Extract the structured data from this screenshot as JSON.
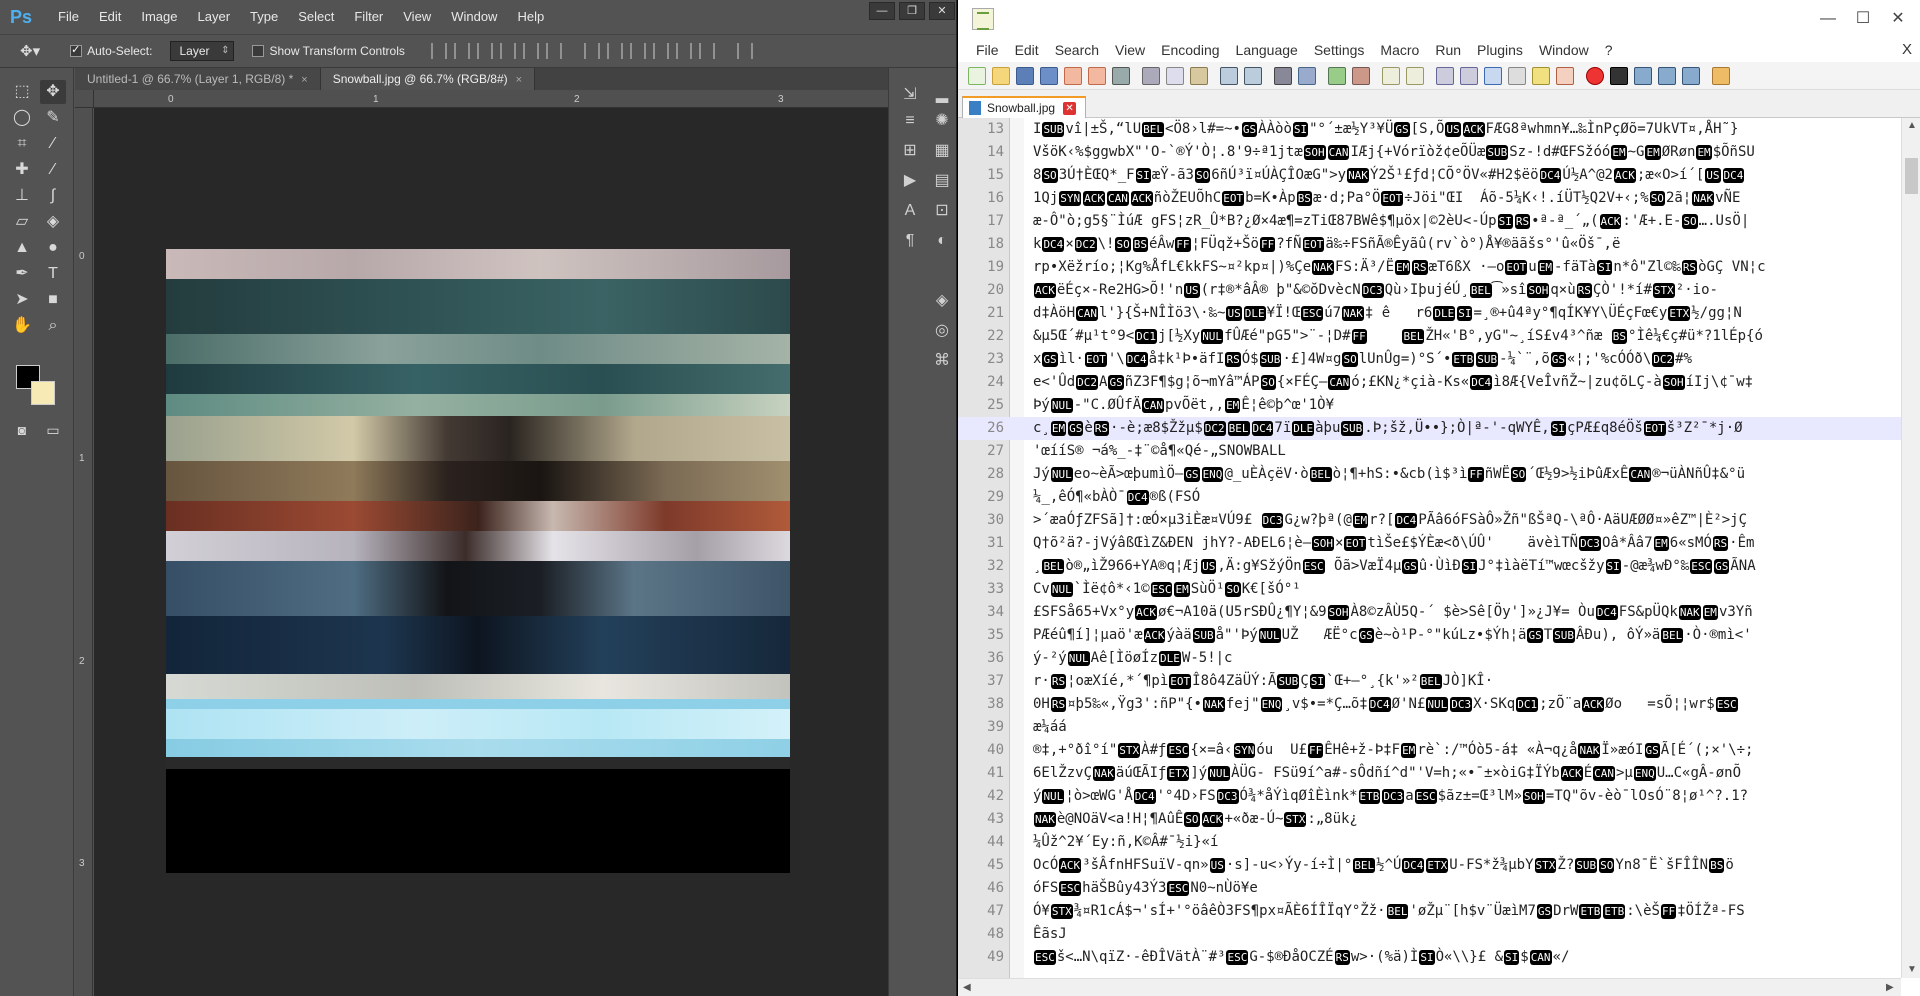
{
  "photoshop": {
    "logo": "Ps",
    "menu": [
      "File",
      "Edit",
      "Image",
      "Layer",
      "Type",
      "Select",
      "Filter",
      "View",
      "Window",
      "Help"
    ],
    "window_controls": [
      "—",
      "❐",
      "✕"
    ],
    "options": {
      "auto_select_label": "Auto-Select:",
      "auto_select_value": "Layer",
      "show_transform_label": "Show Transform Controls"
    },
    "tabs": [
      {
        "label": "Untitled-1 @ 66.7% (Layer 1, RGB/8) *",
        "close": "×"
      },
      {
        "label": "Snowball.jpg @ 66.7% (RGB/8#)",
        "close": "×"
      }
    ],
    "ruler_h_ticks": [
      "0",
      "1",
      "2",
      "3"
    ],
    "ruler_v_ticks": [
      "0",
      "1",
      "2",
      "3"
    ],
    "colors": {
      "foreground": "#000000",
      "background": "#f8eab5"
    }
  },
  "notepadpp": {
    "window_controls": [
      "—",
      "☐",
      "✕"
    ],
    "menu": [
      "File",
      "Edit",
      "Search",
      "View",
      "Encoding",
      "Language",
      "Settings",
      "Macro",
      "Run",
      "Plugins",
      "Window",
      "?"
    ],
    "menu_close": "X",
    "tab": {
      "label": "Snowball.jpg"
    },
    "lines": [
      {
        "n": "13",
        "t": "ISUBvî|±Š,“lUBEL<Ö8›l#=~•GSÀÀòòSI\"°´±æ½Y³¥ÜGS[S,ÕUSACKFÆG8ªwhmn¥…‰ÌnPçØõ=7UkVT¤,ÅH˜}"
      },
      {
        "n": "14",
        "t": "VšöK‹%$ggwbX\"'O-`®Ý'Ò¦.8'9÷ª1jtæSOHCANIÆj{+Vórïòž¢eÕÜæSUBSz-!d#ŒFSžóóEM~GEMØRønEM$ÕñSU"
      },
      {
        "n": "15",
        "t": "8SO3Ú†ÈŒQ*_FSIæŸ-ã3SO6ñÚ³ï¤ÚÀÇÎOæG\">yNAKÝ2Š¹£ƒd¦CÕ°ÖV«#H2$ëöDC4Ú½A^@2ACK;æ«O>í´[USDC4"
      },
      {
        "n": "16",
        "t": "1QjSYNACKCANACKñòŽEUÕhCEOTb=K•ÀpBSæ·d;Pa°ÖEOT÷Jöi\"ŒI  Áõ-5¼K‹!.íÜT½Q2V+‹;%SO2ã¦NAKvÑE"
      },
      {
        "n": "17",
        "t": "æ-Ô\"ò;g5§¨ÌúÆ gFS¦zR_Û*B?¿Ø×4æ¶=zTiŒ87BWê$¶µöx|©2èU<-ÚpSIRS•ª-ª_´„(ACK:'Æ+.E-SO….UsÖ|"
      },
      {
        "n": "18",
        "t": "kDC4×DC2\\!SOBSéÂwFF¦FÜqž+ŠöFF?fÑEOTä‰÷FSñÃ®Êyãû(rv`ò°)Å¥®äãšs°'û«Öš¯,ë"
      },
      {
        "n": "19",
        "t": "rp•Xëžrío;¦Kg%ÅfL€kkFS~¤²kp¤|)%ÇeNAKFS:Ä³/ËEMRSæT6ßX ·—oEOTuEM-fäTàSIn*ô\"Zl©‰RSòGÇ VN¦c"
      },
      {
        "n": "20",
        "t": "ACKëÉç×-Re2HG>Õ!'nUS(r‡®*âÂ® þ\"&©ŏDvècNDC3Qù›IþujéÚ¸BEL͡»sîSOHq×ùRSÇÒ'!*í#STX²·io-"
      },
      {
        "n": "21",
        "t": "d‡ÀöHCANl'}{Š+NÎÌö3\\·‰~USDLE¥Ï!ŒESCú7NAK‡ ê   r6DLESI=¸®+û4ªy°¶qÍK¥Y\\ÜÉçFœ€yETX½/gg¦N"
      },
      {
        "n": "22",
        "t": "&µ5Œ´#µ¹t°9<DC1j[½XyNULfÛÆé\"pG5\">¨-¦D#FF    BELŽH«'B°,yG\"~¸íS£v4³^ñæ BS°Ìê¼€ç#ü*?1lÉp{ó"
      },
      {
        "n": "23",
        "t": "xGSìl·EOT'\\DC4å‡k¹Þ•äfIRSÓ$SUB·£]4W¤gSOlUnÛg=)°S´•ETBSUB-¼`¨,õGS«¦;'%cÓÓð\\DC2#%"
      },
      {
        "n": "24",
        "t": "e<'ÛdDC2AGSñZ3F¶$g¦õ¬mYâ™ÁPSO{×FÉÇ—CANó;£KN¿*çià-Ks«DC4ì8Æ{VeÎvñŽ~|zu¢õLÇ-àSOHíIj\\¢¯w‡"
      },
      {
        "n": "25",
        "t": "ÞýNUL-\"C.ØÛfÄCANpvÕët,‚EMÊ¦ê©þ^œ'1Ò¥"
      },
      {
        "n": "26",
        "t": "c¸EMGSèRS·-è;æ8$Žžµ$DC2BELDC47ïDLEàþuSUB.Þ;šž,Ü••};Ò|ª-'-qWYÊ,SIçPÆ£q8éÖšEOTš³Z²¯*j·Ø"
      },
      {
        "n": "27",
        "t": "'œííS® ¬á%_-‡¨©å¶«Qé-„SNOWBALL"
      },
      {
        "n": "28",
        "t": "JýNULeo~èÃ>œþumìÖ—GSENQ@_uÈÀçëV·òBELò¦¶+hS:•&cb(ì$³ìFFñWËSO´Œ½9>½iÞûÆxÊCAN®¬üÀNñÛ‡&°ü"
      },
      {
        "n": "29",
        "t": "¼_,êÓ¶«bÀÒ¯DC4®ß(FSÓ"
      },
      {
        "n": "30",
        "t": ">´æaÓƒZFSã]†:œÓ×µ3iÈæ¤VÚ9£ DC3G¿w?þª(@EMr?[DC4PÃâ6óFSàÔ»Žñ\"ßŠªQ-\\ªÔ·AäUÆØØ¤»êZ™|È²>jÇ"
      },
      {
        "n": "31",
        "t": "Q†õ²ä?-jVýâßŒìZ&ÐEN jhY?-AÐEL6¦è—SOH×EOTtìŠe£$ÝÈæ<ð\\ÚÛ'    ävèìTÑDC3Oâ*Ââ7EM6«sMÓRS·Êm"
      },
      {
        "n": "32",
        "t": "¸BELò®„ìŽ966+YA®q¦ÆjUS,Ä:g¥SžýÖnESC Õã>VæÏ4µGSû·ÙìÐSIJ°‡ìàëTí™wœcšžySI-@æ¾wÐ°‰ESCGSÃNA"
      },
      {
        "n": "33",
        "t": "CvNUL`Ìë¢ô*‹1©ESCEMSùÖ¹SOK€[šÓ°¹"
      },
      {
        "n": "34",
        "t": "£SFSå65+Vx°yACKø€¬A10ä(U5rSÐÛ¿¶Y¦&9SOHÀ8©zÂÙ5Q-´ $è>Sê[Öy']»¿J¥= ÒuDC4FS&pÜQkNAKEMv3Yñ"
      },
      {
        "n": "35",
        "t": "PÆéû¶í]¦µaö'æACKýàäSUBå\"'ÞýNULUŽ   ÆË°cGSè~ò¹P-°\"kúLz•$Ýh¦äGSTSUBÂÐu), ôÝ»äBEL·Ò·®mì<'"
      },
      {
        "n": "36",
        "t": "ý-²ýNULAê[ÌöøÍzDLEW-5!|c"
      },
      {
        "n": "37",
        "t": "r·RS¦oæXíé,*´¶pìEOTÎ8ô4ZäÜÝ:ÃSUBÇSI`Œ+—°¸{k'»²BELJÒ]KÎ·"
      },
      {
        "n": "38",
        "t": "0HRS¤þ5‰«,Ÿg3':ñP\"{•NAKfej\"ENQ¸v$•=*Ç…õ‡DC4Ø'N£NULDC3X·SKqDC1;zÕ¨aACKØo   =sÕ¦¦wr$ESC"
      },
      {
        "n": "39",
        "t": "æ¼áá"
      },
      {
        "n": "40",
        "t": "®‡,+°ðî°í\"STXÀ#ƒESC{×=â‹SYNóu  U£FFÊHê+ž-Þ‡FEMrè`:/™Óò5-á‡ «À¬q¿åNAKÏ»æóIGSÃ[É´(;×'\\÷;"
      },
      {
        "n": "41",
        "t": "6ElŽzvÇNAKäúŒÃIƒETX]ýNULÀÜG- FSü9í^a#-sÔdñí^d\"'V=h;«•¯±×òiG‡ÏÝbACKÉCAN>µENQU…C«gÂ-ønÕ"
      },
      {
        "n": "42",
        "t": "ýNUL¦ò>œWG'ÅDC4'°4D›FSDC3Ó¾*åÝìqØîÈìnk*ETBDC3aESC$ãz±=Œ³lM»SOH=TQ\"õv-èò¯lOsÓ¨8¦ø¹^?.1?"
      },
      {
        "n": "43",
        "t": "NAKè@NOäV<a!H¦¶AûÊSOACK+«ðæ-Ú~STX:„8ük¿"
      },
      {
        "n": "44",
        "t": "¼Ûž^2¥´Ey:ñ,K©Â#¯½i}«í"
      },
      {
        "n": "45",
        "t": "OcÓACK³šÂfnHFSuïV-qn»US·s]-u<›Ýy-í÷Ì|°BEL½^ÚDC4ETXU-FS*ž¾µbYSTXŽ?SUBSOYn8¯Ë`šFÎÎNBSö"
      },
      {
        "n": "46",
        "t": "óFSESChäŠBûy43Ý3ESCN0~nÙö¥e"
      },
      {
        "n": "47",
        "t": "Ó¥STX¾¤R1cÁ$¬'sÍ+'°öâêÒ3FS¶px¤ÃÈ6ÍÎÏqY°Žž·BEL'øŽµ¨[h$v¨ÜæìM7GSDrWETBETB:\\èŠFF‡ÖÍŽª-FS"
      },
      {
        "n": "48",
        "t": "ÊãsJ"
      },
      {
        "n": "49",
        "t": "ESCš<…N\\qïZ·-êÐÎVätÀ¨#³ESCG-$®ÐåOCZÉRSw>·(%ä)ÌSIÒ«\\\\}£ &SI$CAN«/"
      }
    ]
  }
}
